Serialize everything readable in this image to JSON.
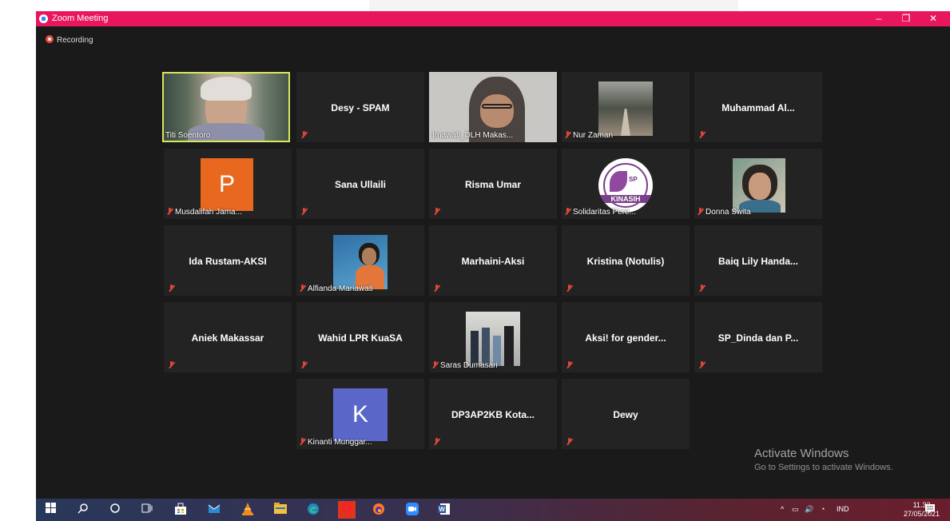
{
  "window": {
    "title": "Zoom Meeting",
    "minimize": "–",
    "restore": "❐",
    "close": "✕"
  },
  "recording": {
    "label": "Recording"
  },
  "tiles": [
    {
      "name": "Titi Soentoro",
      "type": "video"
    },
    {
      "name": "Desy - SPAM",
      "type": "name"
    },
    {
      "name": "Irnawati_DLH Makas...",
      "type": "video"
    },
    {
      "name": "Nur Zaman",
      "type": "photo"
    },
    {
      "name": "Muhammad Al...",
      "type": "name"
    },
    {
      "name": "Musdalifah Jama...",
      "type": "letter",
      "letter": "P",
      "letter_color": "#e8681f"
    },
    {
      "name": "Sana Ullaili",
      "type": "name"
    },
    {
      "name": "Risma Umar",
      "type": "name"
    },
    {
      "name": "Solidaritas Pere...",
      "type": "photo",
      "logo_text": "SP",
      "logo_sub": "KINASIH"
    },
    {
      "name": "Donna Swita",
      "type": "photo"
    },
    {
      "name": "Ida Rustam-AKSI",
      "type": "name"
    },
    {
      "name": "Alfianda Mariawati",
      "type": "photo"
    },
    {
      "name": "Marhaini-Aksi",
      "type": "name"
    },
    {
      "name": "Kristina (Notulis)",
      "type": "name"
    },
    {
      "name": "Baiq Lily Handa...",
      "type": "name"
    },
    {
      "name": "Aniek Makassar",
      "type": "name"
    },
    {
      "name": "Wahid LPR KuaSA",
      "type": "name"
    },
    {
      "name": "Saras Dumasari",
      "type": "photo"
    },
    {
      "name": "Aksi! for gender...",
      "type": "name"
    },
    {
      "name": "SP_Dinda dan P...",
      "type": "name"
    },
    {
      "name": "Kinanti Munggar...",
      "type": "letter",
      "letter": "K",
      "letter_color": "#5a67c8"
    },
    {
      "name": "DP3AP2KB Kota...",
      "type": "name"
    },
    {
      "name": "Dewy",
      "type": "name"
    }
  ],
  "watermark": {
    "line1": "Activate Windows",
    "line2": "Go to Settings to activate Windows."
  },
  "taskbar": {
    "language": "IND",
    "time": "11.33",
    "date": "27/05/2021"
  }
}
